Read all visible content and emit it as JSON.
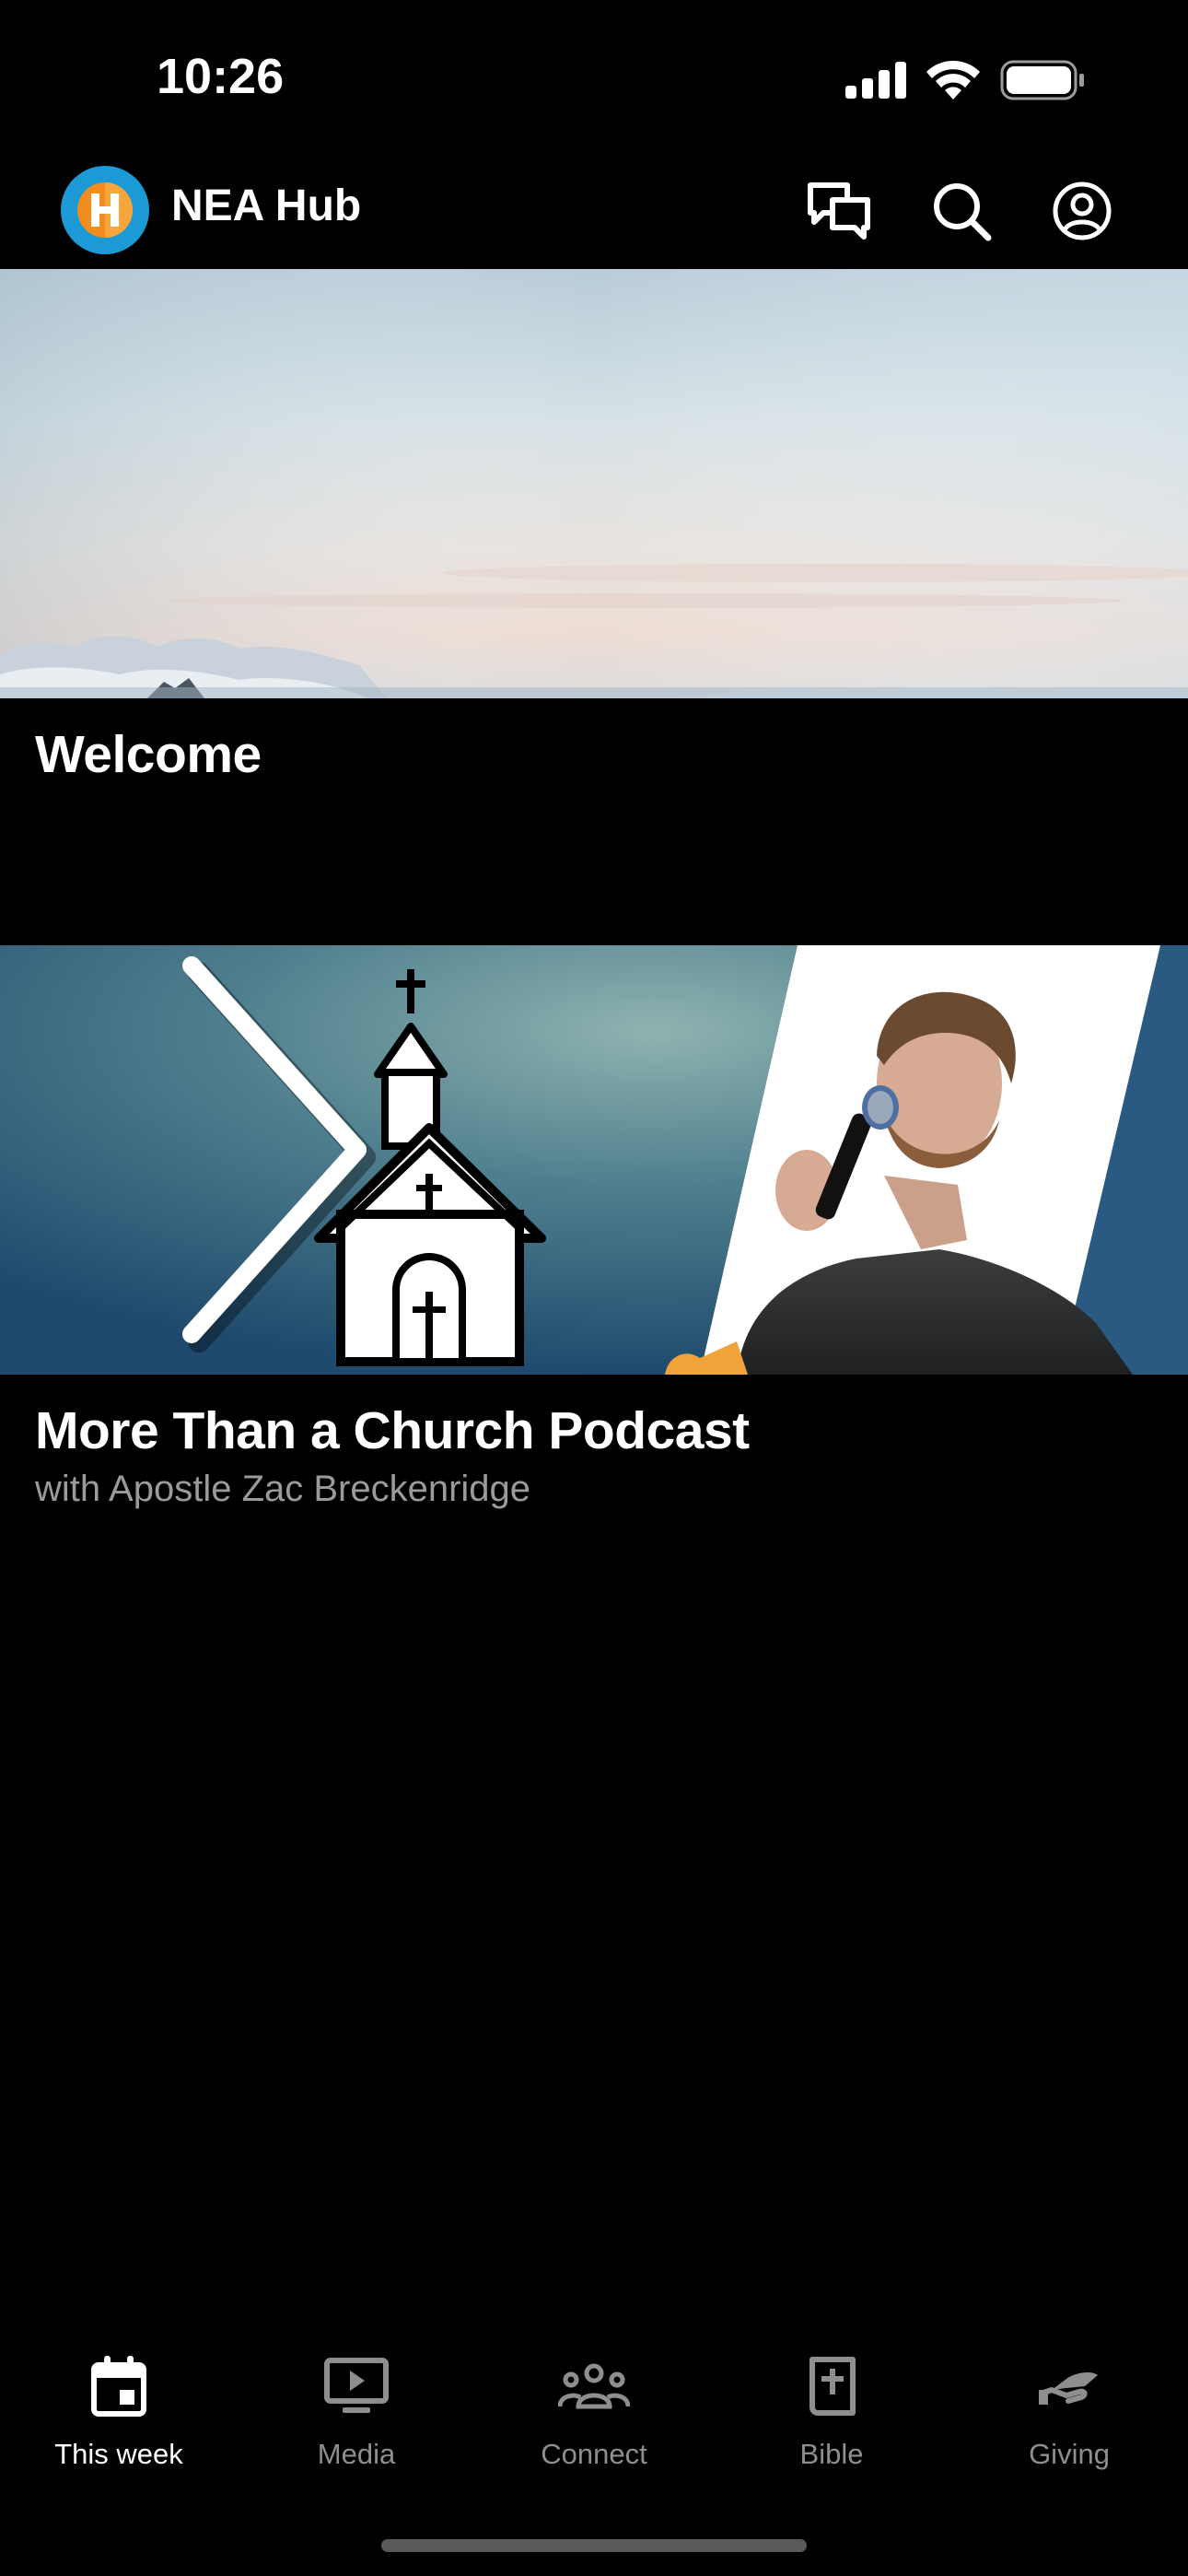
{
  "status_bar": {
    "time": "10:26"
  },
  "header": {
    "app_name": "NEA Hub"
  },
  "cards": [
    {
      "title": "Welcome",
      "subtitle": ""
    },
    {
      "title": "More Than a Church Podcast",
      "subtitle": "with Apostle Zac Breckenridge"
    }
  ],
  "tabs": [
    {
      "label": "This week",
      "icon": "calendar-icon",
      "active": true
    },
    {
      "label": "Media",
      "icon": "play-screen-icon",
      "active": false
    },
    {
      "label": "Connect",
      "icon": "group-icon",
      "active": false
    },
    {
      "label": "Bible",
      "icon": "bible-icon",
      "active": false
    },
    {
      "label": "Giving",
      "icon": "giving-hand-icon",
      "active": false
    }
  ],
  "colors": {
    "accent_blue": "#1b9ad6",
    "accent_orange": "#f28c1c",
    "inactive_tab": "#8e8e8e"
  }
}
